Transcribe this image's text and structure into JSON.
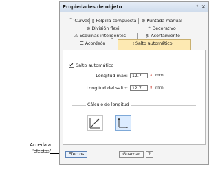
{
  "panel": {
    "title": "Propiedades de objeto",
    "pin_glyph": "ᛜ",
    "close_glyph": "×"
  },
  "tabs": [
    {
      "label": "Curvas",
      "icon": "curve-icon",
      "glyph": "⌒"
    },
    {
      "label": "Felpilla compuesta",
      "icon": "chenille-icon",
      "glyph": "▯"
    },
    {
      "label": "Puntada manual",
      "icon": "manual-stitch-icon",
      "glyph": "⊛"
    },
    {
      "label": "División flexi",
      "icon": "flexi-split-icon",
      "glyph": "⊘"
    },
    {
      "label": "Decorativo",
      "icon": "decorative-icon",
      "glyph": "⁺"
    },
    {
      "label": "Esquinas inteligentes",
      "icon": "smart-corners-icon",
      "glyph": "⚠"
    },
    {
      "label": "Acortamiento",
      "icon": "shortening-icon",
      "glyph": "≶"
    },
    {
      "label": "Acordeón",
      "icon": "accordion-icon",
      "glyph": "☰"
    },
    {
      "label": "Salto automático",
      "icon": "auto-jump-icon",
      "glyph": "⦂",
      "active": true
    }
  ],
  "auto_jump": {
    "checkbox_label": "Salto automático",
    "checked": true,
    "max_length_label": "Longitud máx:",
    "max_length_value": "12.7",
    "jump_length_label": "Longitud del salto:",
    "jump_length_value": "12.7",
    "unit": "mm",
    "spin_glyph": "⇕"
  },
  "calc": {
    "caption": "Cálculo de longitud",
    "options": [
      "diagonal-length-icon",
      "orthogonal-length-icon"
    ],
    "selected": "orthogonal-length-icon"
  },
  "footer": {
    "effects_label": "Efectos",
    "save_label": "Guardar",
    "help_label": "?"
  },
  "annotation": {
    "line1": "Acceda a",
    "line2": "'efectos'"
  },
  "colors": {
    "active_tab": "#fde9b2",
    "titlebar": "#cfdcec",
    "spin_arrow": "#c8362a",
    "selected_option": "#dcecff"
  }
}
